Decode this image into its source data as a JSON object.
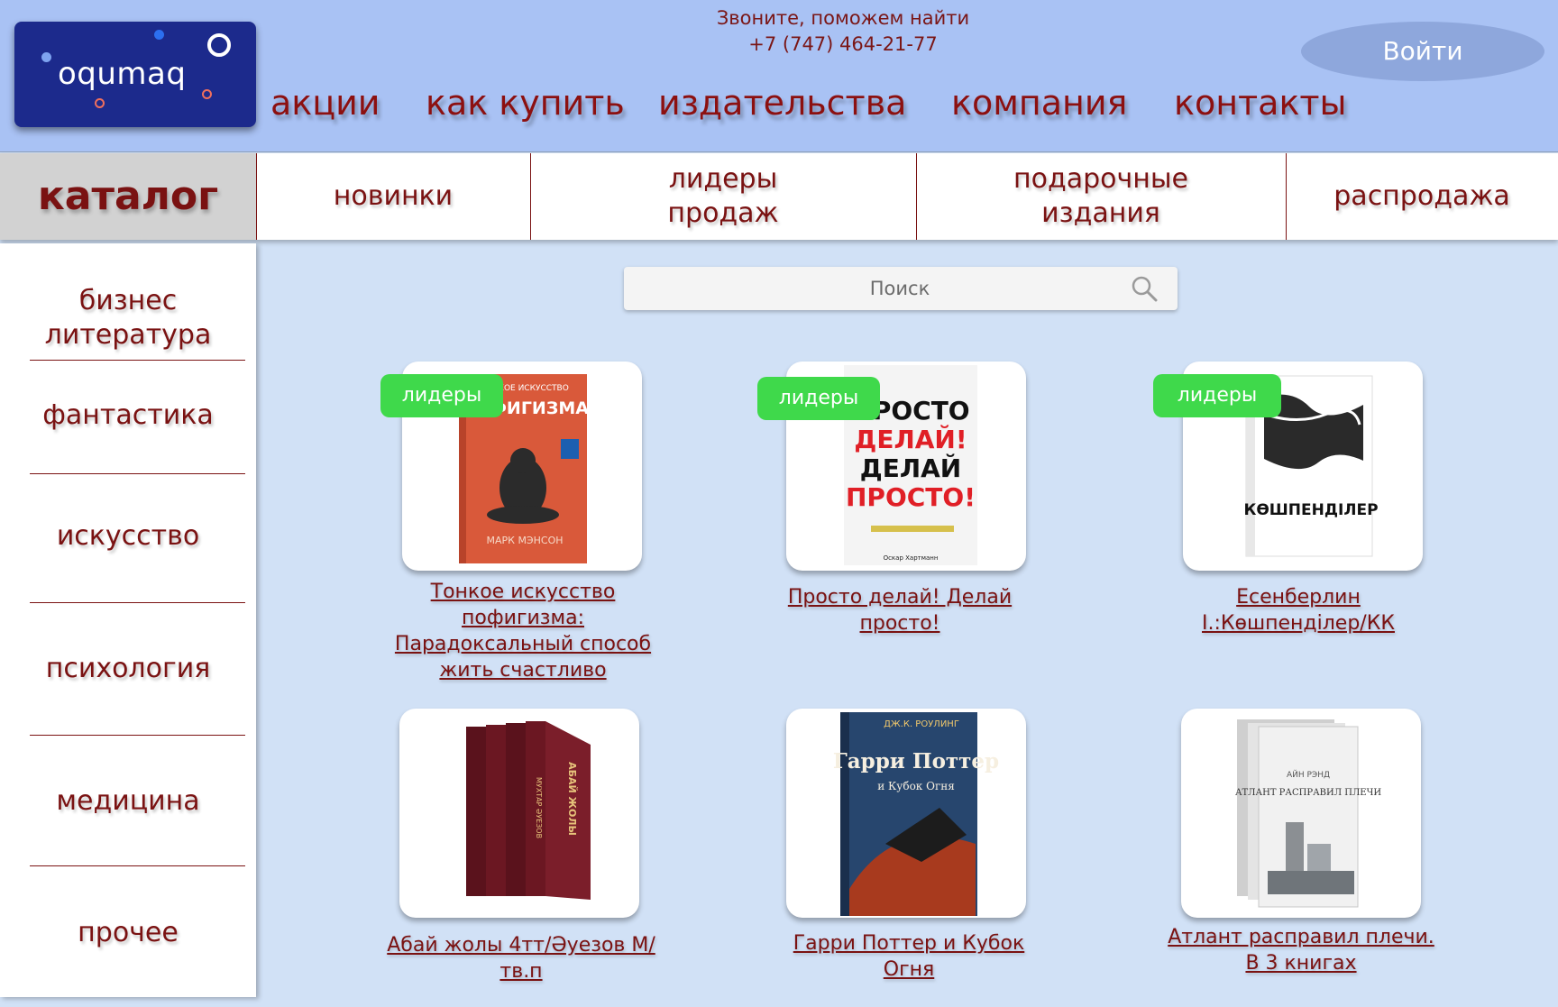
{
  "header": {
    "logo_text": "oqumaq",
    "phone_line1": "Звоните, поможем найти",
    "phone_line2": "+7 (747) 464-21-77",
    "login_label": "Войти",
    "nav": [
      {
        "label": "акции"
      },
      {
        "label": "как купить"
      },
      {
        "label": "издательства"
      },
      {
        "label": "компания"
      },
      {
        "label": "контакты"
      }
    ]
  },
  "catbar": {
    "main_label": "каталог",
    "tabs": [
      {
        "label": "новинки"
      },
      {
        "label": "лидеры\nпродаж"
      },
      {
        "label": "подарочные\nиздания"
      },
      {
        "label": "распродажа"
      }
    ]
  },
  "sidebar": {
    "items": [
      {
        "label": "бизнес литература"
      },
      {
        "label": "фантастика"
      },
      {
        "label": "искусство"
      },
      {
        "label": "психология"
      },
      {
        "label": "медицина"
      },
      {
        "label": "прочее"
      }
    ]
  },
  "search": {
    "placeholder": "Поиск",
    "icon": "search-icon"
  },
  "products": [
    {
      "title": "Тонкое искусство пофигизма: Парадоксальный способ жить счастливо",
      "badge": "лидеры"
    },
    {
      "title": "Просто делай! Делай просто!",
      "badge": "лидеры"
    },
    {
      "title": "Есенберлин І.:Көшпенділер/КК",
      "badge": "лидеры"
    },
    {
      "title": "Абай жолы 4тт/Әуезов М/ тв.п",
      "badge": ""
    },
    {
      "title": "Гарри Поттер и Кубок Огня",
      "badge": ""
    },
    {
      "title": "Атлант расправил плечи. В 3 книгах",
      "badge": ""
    }
  ],
  "covers": {
    "book1": {
      "top": "ТОНКОЕ ИСКУССТВО",
      "main": "ПОФИГИЗМА",
      "author": "МАРК МЭНСОН",
      "color": "#d9593a"
    },
    "book2": {
      "line1": "ПРОСТО",
      "line2": "ДЕЛАЙ!",
      "line3": "ДЕЛАЙ",
      "line4": "ПРОСТО!",
      "author": "Оскар Хартманн"
    },
    "book3": {
      "main": "КӨШПЕНДІЛЕР"
    },
    "book4": {
      "main": "АБАЙ ЖОЛЫ",
      "author": "МУХТАР ӘУЕЗОВ",
      "color": "#6b1722"
    },
    "book5": {
      "author": "ДЖ.К. РОУЛИНГ",
      "main": "Гарри Поттер",
      "sub": "и Кубок Огня"
    },
    "book6": {
      "author": "АЙН РЭНД",
      "main": "АТЛАНТ РАСПРАВИЛ ПЛЕЧИ"
    }
  }
}
